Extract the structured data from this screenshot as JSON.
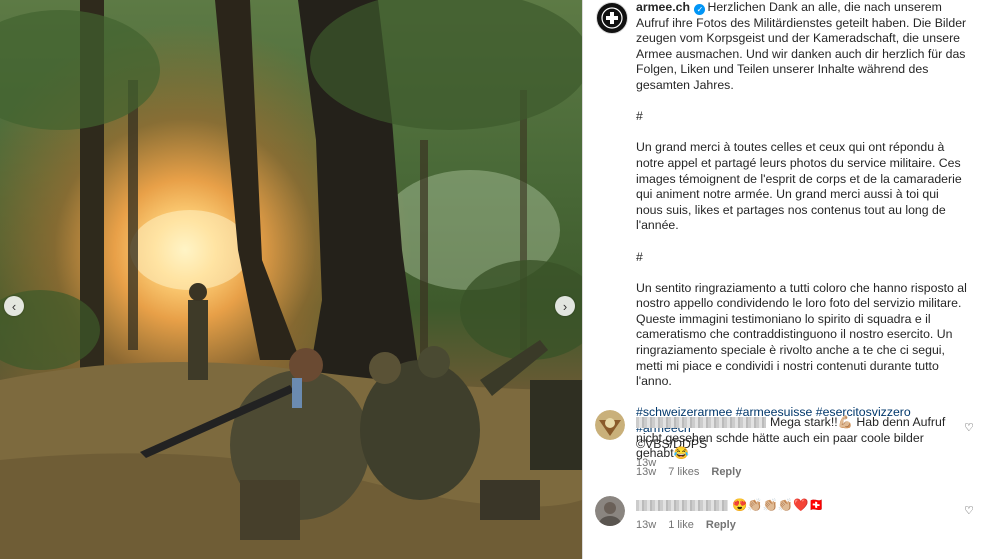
{
  "post": {
    "username": "armee.ch",
    "caption_de": "Herzlichen Dank an alle, die nach unserem Aufruf ihre Fotos des Militärdienstes geteilt haben. Die Bilder zeugen vom Korpsgeist und der Kameradschaft, die unsere Armee ausmachen. Und wir danken auch dir herzlich für das Folgen, Liken und Teilen unserer Inhalte während des gesamten Jahres.",
    "separator1": "#",
    "caption_fr": "Un grand merci à toutes celles et ceux qui ont répondu à notre appel et partagé leurs photos du service militaire. Ces images témoignent de l'esprit de corps et de la camaraderie qui animent notre armée. Un grand merci aussi à toi qui nous suis, likes et partages nos contenus tout au long de l'année.",
    "separator2": "#",
    "caption_it": "Un sentito ringraziamento a tutti coloro che hanno risposto al nostro appello condividendo le loro foto del servizio militare. Queste immagini testimoniano lo spirito di squadra e il cameratismo che contraddistinguono il nostro esercito. Un ringraziamento speciale è rivolto anche a te che ci segui, metti mi piace e condividi i nostri contenuti durante tutto l'anno.",
    "hashtags": "#schweizerarmee #armeesuisse #esercitosvizzero #armeech",
    "credit": "©VBS/DDPS",
    "age": "13w"
  },
  "comments": [
    {
      "text": "Mega stark!!💪🏼 Hab denn Aufruf nicht gesehen schde hätte auch ein paar coole bilder gehabt😂",
      "age": "13w",
      "likes": "7 likes",
      "reply": "Reply"
    },
    {
      "text": "😍👏🏼👏🏼👏🏼❤️🇨🇭",
      "age": "13w",
      "likes": "1 like",
      "reply": "Reply"
    }
  ],
  "icons": {
    "prev": "chevron-left-icon",
    "next": "chevron-right-icon",
    "like": "heart-icon",
    "verified": "verified-badge-icon"
  },
  "nav": {
    "prev_glyph": "‹",
    "next_glyph": "›"
  },
  "colors": {
    "link": "#00376b",
    "verified": "#0095f6",
    "muted": "#737373"
  }
}
